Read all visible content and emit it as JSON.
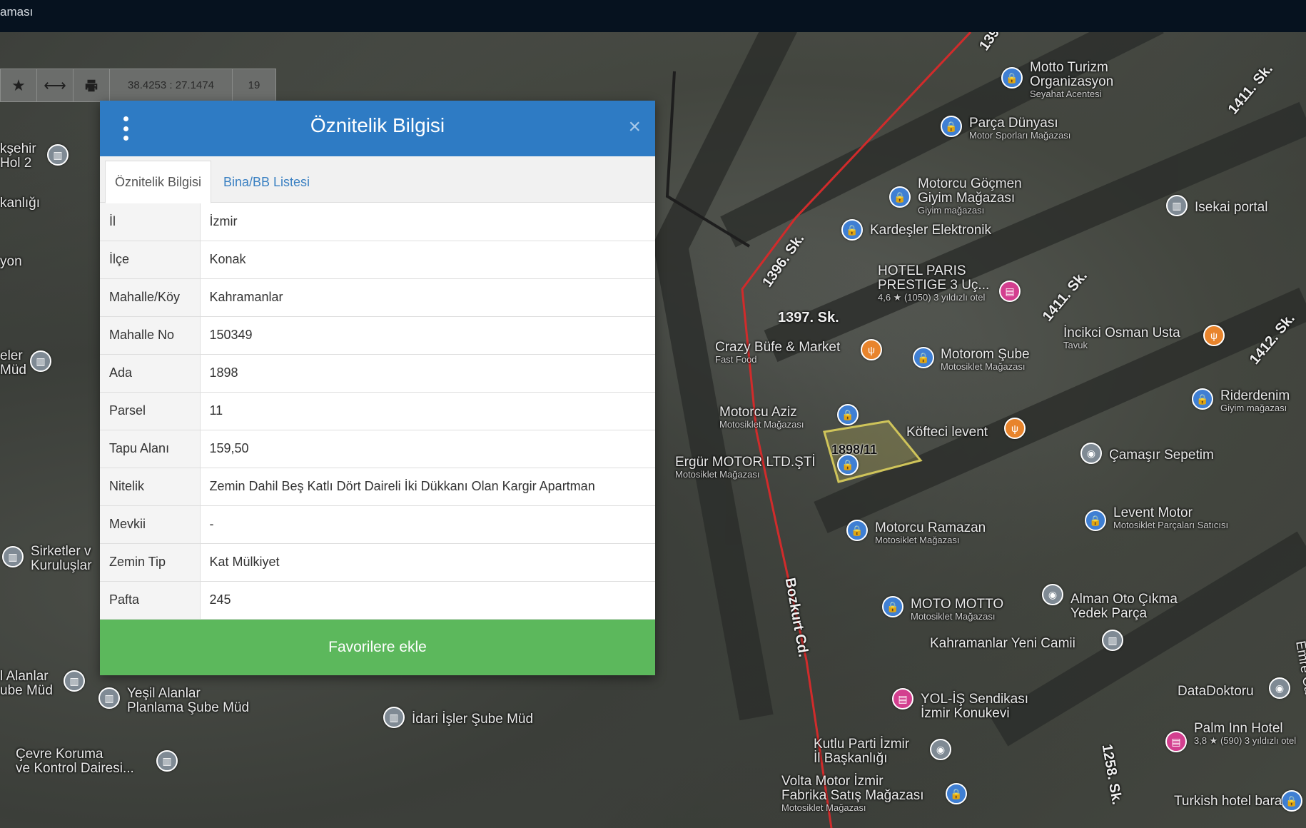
{
  "topbar": {
    "title": "aması"
  },
  "maptools": {
    "coords": "38.4253 : 27.1474",
    "zoom": "19",
    "icons": [
      "star-icon",
      "arrows-horizontal-icon",
      "print-icon"
    ]
  },
  "dialog": {
    "title": "Öznitelik Bilgisi",
    "close": "×",
    "tabs": [
      {
        "label": "Öznitelik Bilgisi",
        "active": true
      },
      {
        "label": "Bina/BB Listesi",
        "active": false
      }
    ],
    "rows": [
      {
        "key": "İl",
        "value": "İzmir"
      },
      {
        "key": "İlçe",
        "value": "Konak"
      },
      {
        "key": "Mahalle/Köy",
        "value": "Kahramanlar"
      },
      {
        "key": "Mahalle No",
        "value": "150349"
      },
      {
        "key": "Ada",
        "value": "1898"
      },
      {
        "key": "Parsel",
        "value": "11"
      },
      {
        "key": "Tapu Alanı",
        "value": "159,50"
      },
      {
        "key": "Nitelik",
        "value": "Zemin Dahil Beş Katlı Dört Daireli İki Dükkanı Olan Kargir Apartman"
      },
      {
        "key": "Mevkii",
        "value": "-"
      },
      {
        "key": "Zemin Tip",
        "value": "Kat Mülkiyet"
      },
      {
        "key": "Pafta",
        "value": "245"
      }
    ],
    "button": "Favorilere ekle"
  },
  "map": {
    "parcel_label": "1898/11",
    "streets": [
      "1396. Sk.",
      "1397. Sk.",
      "1411. Sk.",
      "1411. Sk.",
      "1412. Sk.",
      "Bozkurt Cd.",
      "1258. Sk.",
      "139"
    ],
    "places": [
      {
        "name": "Motto Turizm",
        "name2": "Organizasyon",
        "sub": "Seyahat Acentesi",
        "pin": "blue"
      },
      {
        "name": "Parça Dünyası",
        "sub": "Motor Sporları Mağazası",
        "pin": "blue"
      },
      {
        "name": "Motorcu Göçmen",
        "name2": "Giyim Mağazası",
        "sub": "Giyim mağazası",
        "pin": "blue"
      },
      {
        "name": "Kardeşler Elektronik",
        "pin": "blue"
      },
      {
        "name": "Isekai portal",
        "pin": "gray"
      },
      {
        "name": "HOTEL PARIS",
        "name2": "PRESTIGE 3 Uç...",
        "sub": "4,6 ★ (1050) 3 yıldızlı otel",
        "pin": "pink"
      },
      {
        "name": "İncikci Osman Usta",
        "sub": "Tavuk",
        "pin": "orange"
      },
      {
        "name": "Crazy Büfe & Market",
        "sub": "Fast Food",
        "pin": "orange"
      },
      {
        "name": "Motorom Şube",
        "sub": "Motosiklet Mağazası",
        "pin": "blue"
      },
      {
        "name": "Riderdenim",
        "sub": "Giyim mağazası",
        "pin": "blue"
      },
      {
        "name": "Motorcu Aziz",
        "sub": "Motosiklet Mağazası",
        "pin": "blue"
      },
      {
        "name": "Köfteci levent",
        "pin": "orange"
      },
      {
        "name": "Çamaşır Sepetim",
        "pin": "gray"
      },
      {
        "name": "Ergür MOTOR LTD.ŞTİ",
        "sub": "Motosiklet Mağazası",
        "pin": "blue"
      },
      {
        "name": "Levent Motor",
        "sub": "Motosiklet Parçaları Satıcısı",
        "pin": "blue"
      },
      {
        "name": "Motorcu Ramazan",
        "sub": "Motosiklet Mağazası",
        "pin": "blue"
      },
      {
        "name": "MOTO MOTTO",
        "sub": "Motosiklet Mağazası",
        "pin": "blue"
      },
      {
        "name": "Alman Oto Çıkma",
        "name2": "Yedek Parça",
        "pin": "gray"
      },
      {
        "name": "Kahramanlar Yeni Camii",
        "pin": "gray"
      },
      {
        "name": "YOL-İŞ Sendikası",
        "name2": "İzmir Konukevi",
        "pin": "pink"
      },
      {
        "name": "DataDoktoru",
        "pin": "gray"
      },
      {
        "name": "Palm Inn Hotel",
        "sub": "3,8 ★ (590) 3 yıldızlı otel",
        "pin": "pink"
      },
      {
        "name": "Kutlu Parti İzmir",
        "name2": "İl Başkanlığı",
        "pin": "gray"
      },
      {
        "name": "Volta Motor İzmir",
        "name2": "Fabrika Satış Mağazası",
        "sub": "Motosiklet Mağazası",
        "pin": "blue"
      },
      {
        "name": "Turkish hotel bara",
        "pin": "blue"
      },
      {
        "name": "İdari İşler Şube Müd",
        "pin": "gray"
      },
      {
        "name": "Yeşil Alanlar",
        "name2": "Planlama Şube Müd",
        "pin": "gray"
      },
      {
        "name": "Çevre Koruma",
        "name2": "ve Kontrol Dairesi...",
        "pin": "gray"
      },
      {
        "name": "l Alanlar",
        "name2": "ube Müd",
        "pin": "gray"
      },
      {
        "name": "Sirketler v",
        "name2": "Kuruluşlar",
        "pin": "gray"
      },
      {
        "name": "kşehir",
        "name2": "Hol 2",
        "pin": "gray"
      },
      {
        "name": "kanlığı"
      },
      {
        "name": "yon"
      },
      {
        "name": "eler",
        "name2": "Müd",
        "pin": "gray"
      },
      {
        "name": "Emre Ca"
      }
    ]
  }
}
